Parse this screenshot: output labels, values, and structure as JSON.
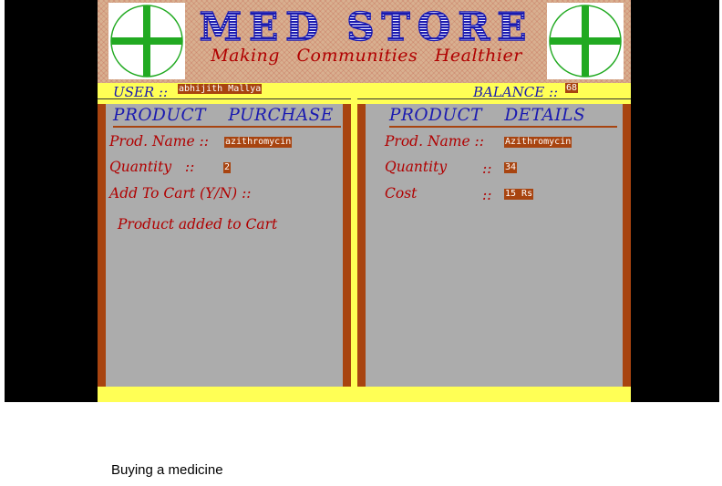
{
  "banner": {
    "title": "MED STORE",
    "tagline": "Making Communities Healthier",
    "cross_icon": "medical-cross-icon",
    "colors": {
      "title": "#1a1ab0",
      "tagline": "#b00000",
      "cross": "#22aa22"
    }
  },
  "status": {
    "user_label": "USER ::",
    "user_value": "abhijith Mallya",
    "balance_label": "BALANCE ::",
    "balance_value": "68"
  },
  "purchase_panel": {
    "title": "PRODUCT PURCHASE",
    "prod_name_label": "Prod. Name ::",
    "prod_name_value": "azithromycin",
    "quantity_label": "Quantity   ::",
    "quantity_value": "2",
    "add_to_cart_label": "Add To Cart (Y/N) ::",
    "message": "Product added to Cart"
  },
  "details_panel": {
    "title": "PRODUCT DETAILS",
    "prod_name_label": "Prod. Name ::",
    "prod_name_value": "Azithromycin",
    "quantity_label": "Quantity",
    "quantity_sep": "::",
    "quantity_value": "34",
    "cost_label": "Cost",
    "cost_sep": "::",
    "cost_value": "15 Rs"
  },
  "caption": "Buying a medicine",
  "colors": {
    "frame_yellow": "#ffff55",
    "panel_gray": "#acacac",
    "border_brown": "#a84410",
    "label_red": "#b00000",
    "heading_blue": "#1a1ab0"
  }
}
